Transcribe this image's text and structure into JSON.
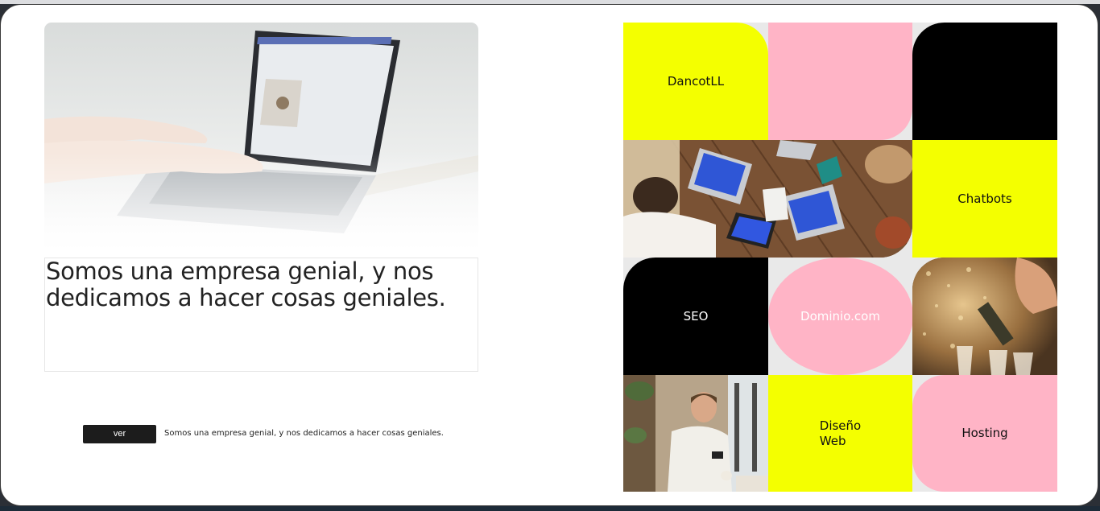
{
  "hero": {
    "heading": "Somos una empresa genial, y nos dedicamos a hacer cosas geniales."
  },
  "cta": {
    "button_label": "ver",
    "caption": "Somos una empresa genial, y nos dedicamos a hacer cosas geniales."
  },
  "grid": {
    "tiles": [
      {
        "label": "DancotLL",
        "color": "#f4ff00"
      },
      {
        "label": "",
        "color": "#ffb4c6"
      },
      {
        "label": "",
        "color": "#000000"
      },
      {
        "label": "Chatbots",
        "color": "#f4ff00"
      },
      {
        "label": "SEO",
        "color": "#000000"
      },
      {
        "label": "Dominio.com",
        "color": "#ffb4c6"
      },
      {
        "label": "Diseño\nWeb",
        "color": "#f4ff00"
      },
      {
        "label": "Hosting",
        "color": "#ffb4c6"
      }
    ]
  },
  "colors": {
    "yellow": "#f4ff00",
    "pink": "#ffb4c6",
    "black": "#000000",
    "button": "#1c1c1c"
  }
}
